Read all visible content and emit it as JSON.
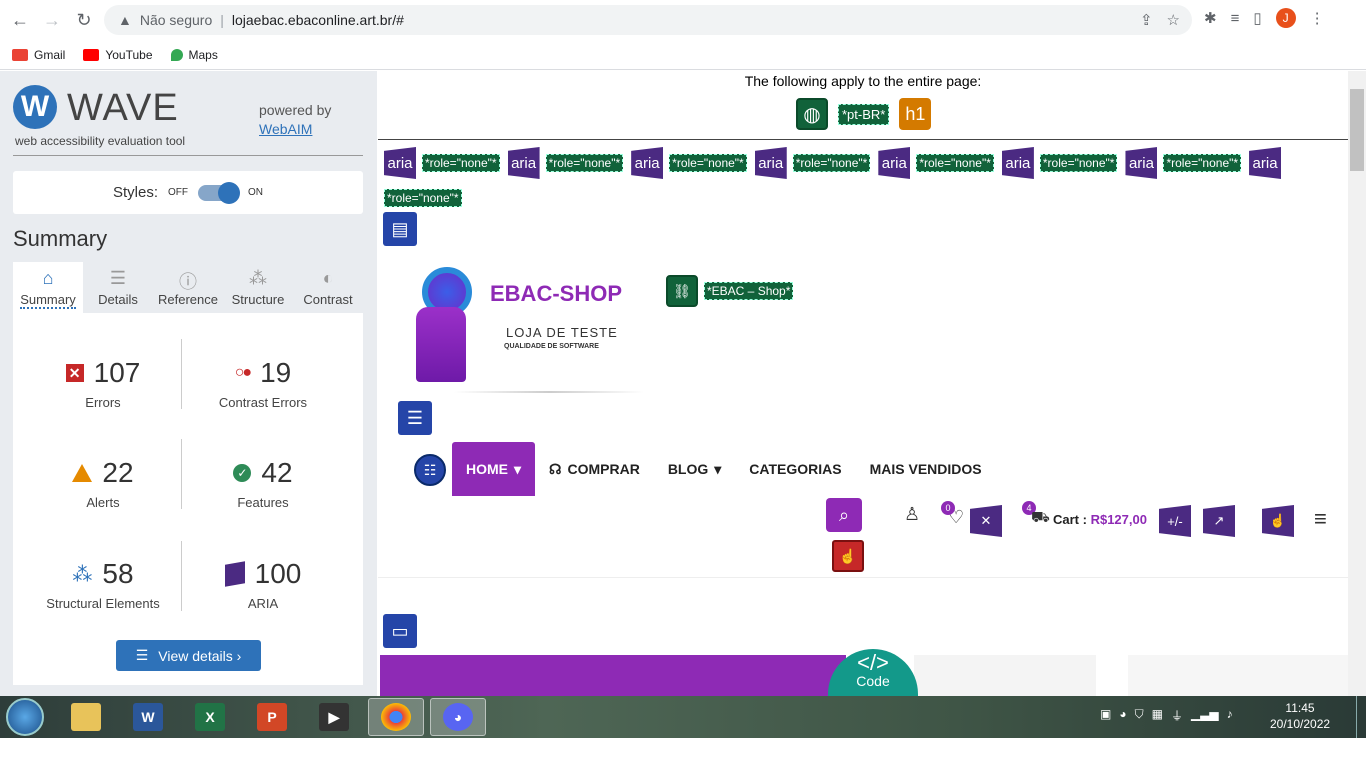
{
  "browser": {
    "security_label": "Não seguro",
    "url": "lojaebac.ebaconline.art.br/#",
    "profile_initial": "J"
  },
  "bookmarks": [
    {
      "label": "Gmail",
      "color": "#ea4335"
    },
    {
      "label": "YouTube",
      "color": "#ff0000"
    },
    {
      "label": "Maps",
      "color": "#34a853"
    }
  ],
  "wave": {
    "logo_letter": "W",
    "name": "WAVE",
    "subtitle": "web accessibility evaluation tool",
    "powered_by": "powered by",
    "powered_link": "WebAIM",
    "styles_label": "Styles:",
    "styles_off": "OFF",
    "styles_on": "ON",
    "summary_title": "Summary",
    "tabs": [
      {
        "label": "Summary",
        "icon": "home-icon",
        "glyph": "⌂"
      },
      {
        "label": "Details",
        "icon": "list-icon",
        "glyph": "☰"
      },
      {
        "label": "Reference",
        "icon": "info-icon",
        "glyph": "ⓘ"
      },
      {
        "label": "Structure",
        "icon": "structure-icon",
        "glyph": "⁂"
      },
      {
        "label": "Contrast",
        "icon": "contrast-icon",
        "glyph": "◐"
      }
    ],
    "stats": {
      "errors": {
        "value": "107",
        "label": "Errors"
      },
      "contrast_errors": {
        "value": "19",
        "label": "Contrast Errors"
      },
      "alerts": {
        "value": "22",
        "label": "Alerts"
      },
      "features": {
        "value": "42",
        "label": "Features"
      },
      "structural": {
        "value": "58",
        "label": "Structural Elements"
      },
      "aria": {
        "value": "100",
        "label": "ARIA"
      }
    },
    "view_details": "View details ›"
  },
  "page": {
    "entire_page_note": "The following apply to the entire page:",
    "lang_tag": "*pt-BR*",
    "h1_label": "h1",
    "aria_label": "aria",
    "role_tag": "*role=\"none\"*",
    "logo_title": "EBAC-SHOP",
    "logo_sub": "LOJA DE TESTE",
    "logo_sub2": "QUALIDADE DE SOFTWARE",
    "img_alt": "*EBAC – Shop*",
    "menu": [
      {
        "label": "HOME",
        "caret": "▾"
      },
      {
        "label": "COMPRAR",
        "caret": ""
      },
      {
        "label": "BLOG",
        "caret": "▾"
      },
      {
        "label": "CATEGORIAS",
        "caret": ""
      },
      {
        "label": "MAIS VENDIDOS",
        "caret": ""
      }
    ],
    "wishlist_count": "0",
    "cart_count": "4",
    "cart_label": "Cart :",
    "cart_price": "R$127,00",
    "plusminus_label": "+/-",
    "code_badge_glyph": "</>",
    "code_badge_label": "Code"
  },
  "taskbar": {
    "time": "11:45",
    "date": "20/10/2022"
  }
}
